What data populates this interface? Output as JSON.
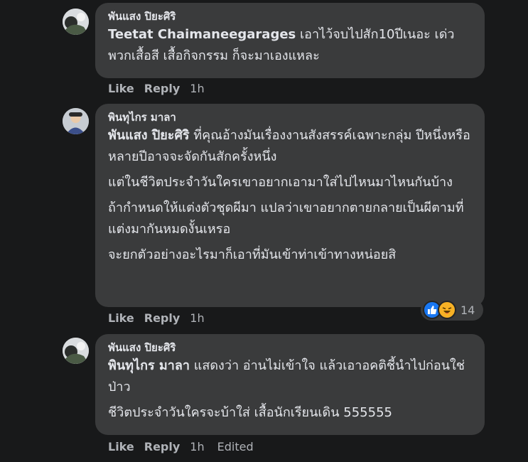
{
  "comments": [
    {
      "author": "พันแสง ปิยะศิริ",
      "mention": "Teetat Chaimaneegarages",
      "paragraphs": [
        "เอาไว้จบไปสัก10ปีเนอะ เด่วพวกเสื้อสี เสื้อกิจกรรม ก็จะมาเองแหละ"
      ],
      "like_label": "Like",
      "reply_label": "Reply",
      "time": "1h"
    },
    {
      "author": "พินทุไกร มาลา",
      "mention": "พันแสง ปิยะศิริ",
      "paragraphs": [
        "ที่คุณอ้างมันเรื่องงานสังสรรค์เฉพาะกลุ่ม ปีหนึ่งหรือหลายปีอาจจะจัดกันสักครั้งหนึ่ง",
        "แต่ในชีวิตประจำวันใครเขาอยากเอามาใส่ไปไหนมาไหนกันบ้าง",
        "ถ้ากำหนดให้แต่งตัวชุดผีมา แปลว่าเขาอยากตายกลายเป็นผีตามที่แต่งมากันหมดงั้นเหรอ",
        "จะยกตัวอย่างอะไรมาก็เอาที่มันเข้าท่าเข้าทางหน่อยสิ"
      ],
      "like_label": "Like",
      "reply_label": "Reply",
      "time": "1h",
      "reactions": {
        "icons": [
          "like-icon",
          "haha-icon"
        ],
        "count": "14"
      }
    },
    {
      "author": "พันแสง ปิยะศิริ",
      "mention": "พินทุไกร มาลา",
      "paragraphs": [
        "แสดงว่า อ่านไม่เข้าใจ แล้วเอาอคติชี้นำไปก่อนใช่ป่าว",
        "ชีวิตประจำวันใครจะบ้าใส่ เสื้อนักเรียนเดิน 555555"
      ],
      "like_label": "Like",
      "reply_label": "Reply",
      "time": "1h",
      "edited_label": "Edited"
    }
  ],
  "colors": {
    "background": "#18191a",
    "bubble": "#3a3b3c",
    "text": "#e4e6eb",
    "secondary_text": "#b0b3b8",
    "like_blue": "#1877f2",
    "haha_yellow": "#f7b125"
  }
}
